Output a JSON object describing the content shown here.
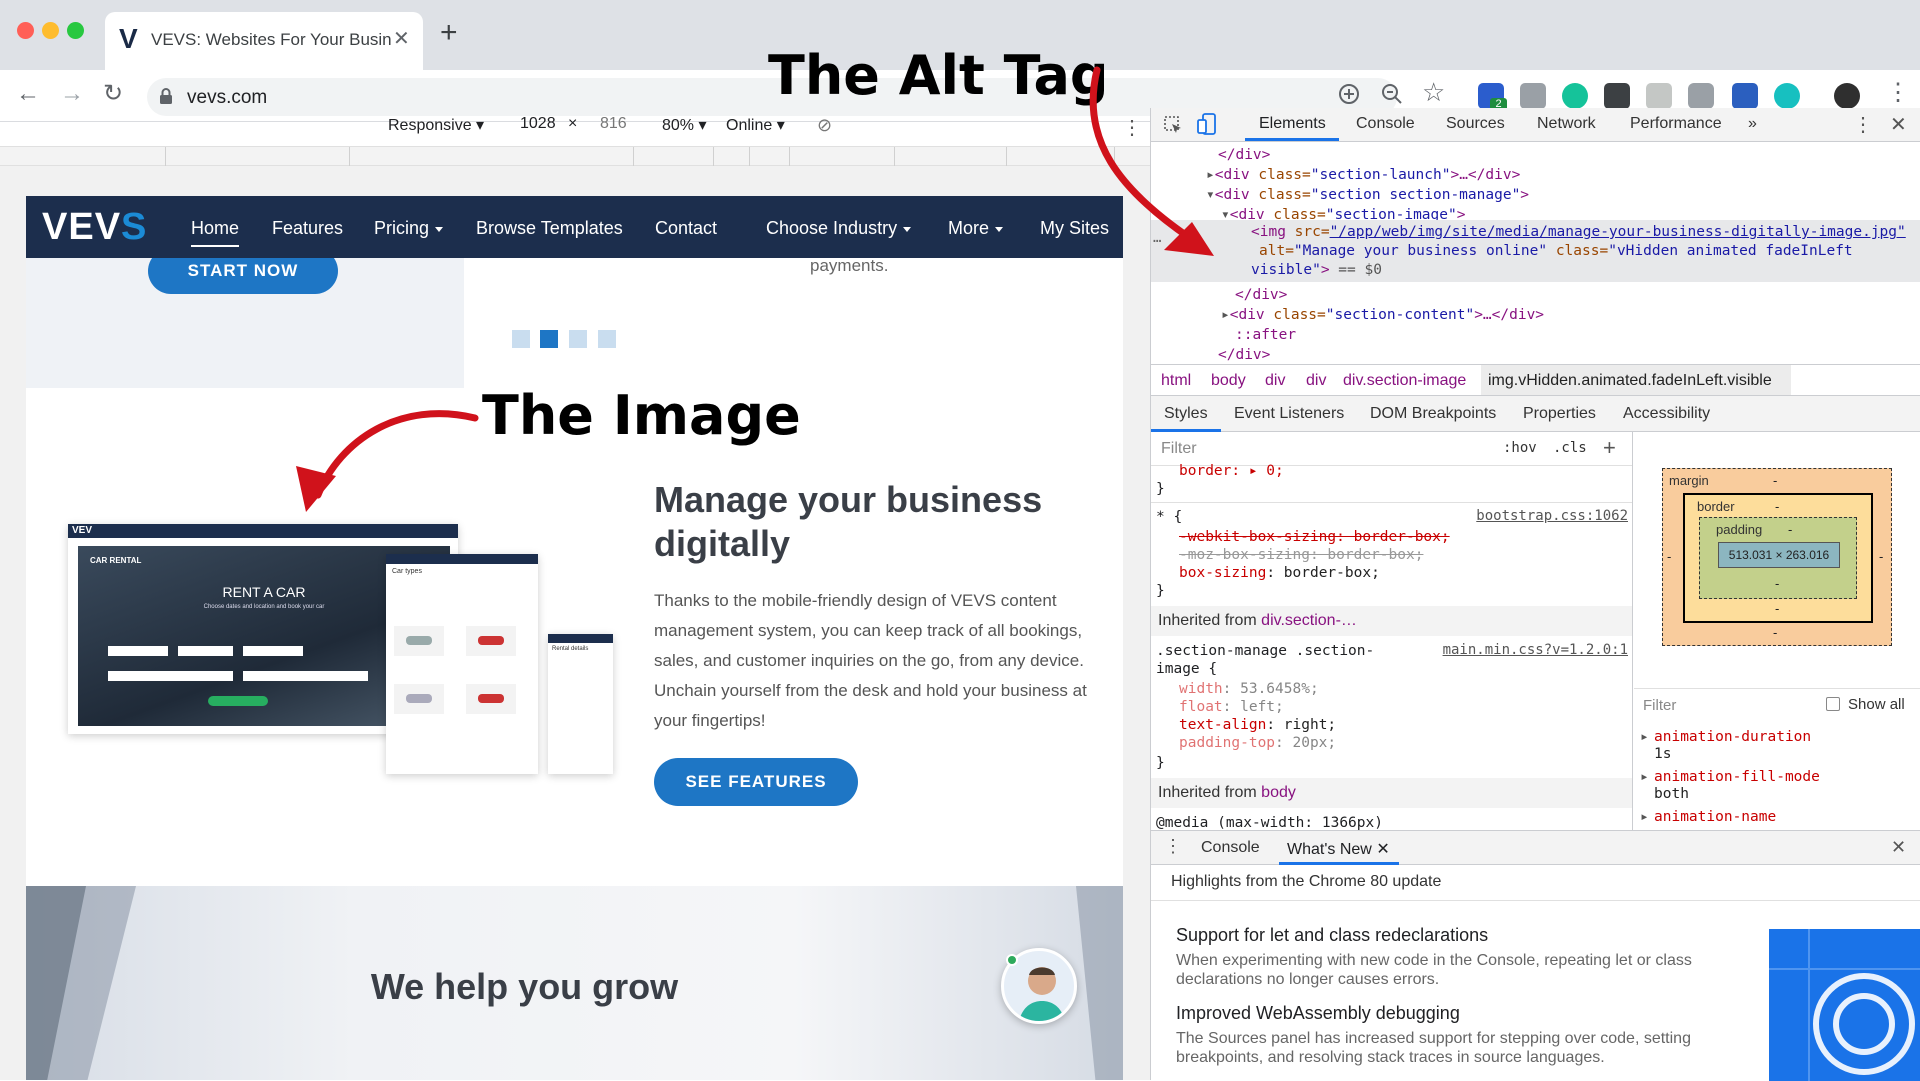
{
  "browser": {
    "tab_title": "VEVS: Websites For Your Busin",
    "tab_logo": "V",
    "url": "vevs.com",
    "extension_badge": "2"
  },
  "device_toolbar": {
    "mode": "Responsive",
    "width": "1028",
    "times": "×",
    "height": "816",
    "zoom": "80%",
    "network": "Online"
  },
  "annotations": {
    "alt_tag": "The Alt Tag",
    "image": "The Image"
  },
  "site": {
    "brand": "VEV",
    "brand_accent": "S",
    "nav": [
      {
        "label": "Home",
        "dropdown": false
      },
      {
        "label": "Features",
        "dropdown": false
      },
      {
        "label": "Pricing",
        "dropdown": true
      },
      {
        "label": "Browse Templates",
        "dropdown": false
      },
      {
        "label": "Contact",
        "dropdown": false
      },
      {
        "label": "Choose Industry",
        "dropdown": true
      },
      {
        "label": "More",
        "dropdown": true
      },
      {
        "label": "My Sites",
        "dropdown": false
      }
    ],
    "start_now": "START NOW",
    "payments_text": "payments.",
    "carousel_active": 2,
    "carousel_count": 4,
    "mockup": {
      "logo": "VEV",
      "rent_title": "RENT A CAR",
      "rent_sub": "Choose dates and location and book your car",
      "panel_title": "Car types",
      "side_title": "Rental details",
      "car_rental_label": "CAR RENTAL"
    },
    "section_title": "Manage your business digitally",
    "section_body": "Thanks to the mobile-friendly design of VEVS content management system, you can keep track of all bookings, sales, and customer inquiries on the go, from any device. Unchain yourself from the desk and hold your business at your fingertips!",
    "see_features": "SEE FEATURES",
    "grow_title": "We help you grow"
  },
  "devtools": {
    "tabs": [
      "Elements",
      "Console",
      "Sources",
      "Network",
      "Performance",
      "»"
    ],
    "dom": {
      "close_div": "</div>",
      "launch_tag_open": "<div ",
      "launch_attr": "class=",
      "launch_val": "\"section-launch\"",
      "launch_tail": ">…</div>",
      "manage_val": "\"section section-manage\"",
      "image_val": "\"section-image\"",
      "img_src_attr": "src=",
      "img_src": "\"/app/web/img/site/media/manage-your-business-digitally-image.jpg\"",
      "img_alt_attr": "alt=",
      "img_alt": "\"Manage your business online\"",
      "img_class_attr": "class=",
      "img_class": "\"vHidden animated fadeInLeft",
      "img_class2": "visible\"",
      "dollar": " == $0",
      "content_val": "\"section-content\"",
      "after": "::after"
    },
    "breadcrumbs": [
      "html",
      "body",
      "div",
      "div",
      "div.section-image",
      "img.vHidden.animated.fadeInLeft.visible"
    ],
    "subtabs": [
      "Styles",
      "Event Listeners",
      "DOM Breakpoints",
      "Properties",
      "Accessibility"
    ],
    "styles": {
      "filter_placeholder": "Filter",
      "hov": ":hov",
      "cls": ".cls",
      "border_line": "border: ▸ 0;",
      "close_brace": "}",
      "star_selector": "* {",
      "star_source": "bootstrap.css:1062",
      "webkit_box": "-webkit-box-sizing: border-box;",
      "moz_box": "-moz-box-sizing: border-box;",
      "box_sizing_prop": "box-sizing",
      "box_sizing_val": ": border-box;",
      "inherited_from_1_label": "Inherited from",
      "inherited_from_1": "div.section-…",
      "rule2_selector_1": ".section-manage .section-",
      "rule2_selector_2": "image {",
      "rule2_source": "main.min.css?v=1.2.0:1",
      "props": [
        {
          "p": "width",
          "v": ": 53.6458%;",
          "dim": true
        },
        {
          "p": "float",
          "v": ": left;",
          "dim": true
        },
        {
          "p": "text-align",
          "v": ": right;",
          "dim": false
        },
        {
          "p": "padding-top",
          "v": ": 20px;",
          "dim": true
        }
      ],
      "inherited_from_2_label": "Inherited from",
      "inherited_from_2": "body",
      "media": "@media (max-width: 1366px)"
    },
    "box_model": {
      "margin": "margin",
      "border": "border",
      "padding": "padding",
      "dash": "-",
      "content": "513.031 × 263.016"
    },
    "computed": {
      "filter": "Filter",
      "show_all": "Show all",
      "items": [
        {
          "p": "animation-duration",
          "v": "1s"
        },
        {
          "p": "animation-fill-mode",
          "v": "both"
        },
        {
          "p": "animation-name",
          "v": ""
        }
      ]
    },
    "drawer": {
      "tabs": [
        "Console",
        "What's New"
      ],
      "highlights": "Highlights from the Chrome 80 update",
      "items": [
        {
          "title": "Support for let and class redeclarations",
          "body": "When experimenting with new code in the Console, repeating let or class declarations no longer causes errors."
        },
        {
          "title": "Improved WebAssembly debugging",
          "body": "The Sources panel has increased support for stepping over code, setting breakpoints, and resolving stack traces in source languages."
        }
      ]
    }
  },
  "colors": {
    "site_nav": "#1c2e4d",
    "accent_blue": "#1e76c5",
    "annotation_arrow": "#d0121b"
  }
}
